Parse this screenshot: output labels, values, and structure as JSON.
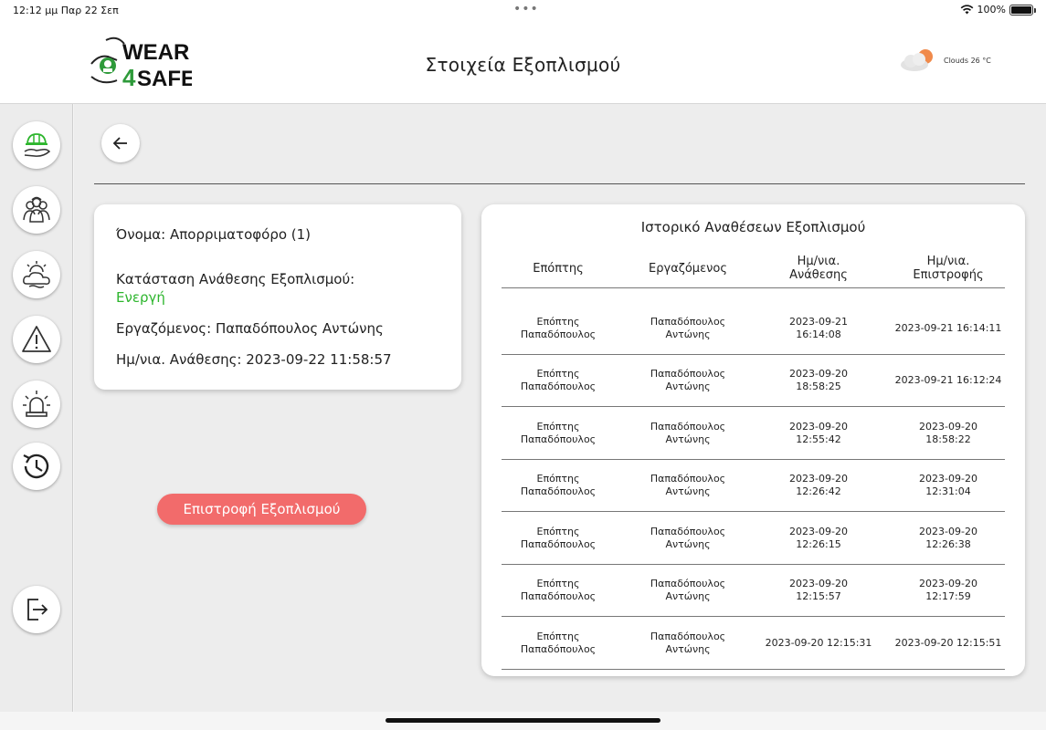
{
  "status_bar": {
    "time": "12:12 μμ   Παρ 22 Σεπ",
    "battery": "100%"
  },
  "header": {
    "logo_text_top": "WEAR",
    "logo_text_mid": "4",
    "logo_text_bottom": "SAFE",
    "title": "Στοιχεία Εξοπλισμού",
    "weather": "Clouds 26 °C"
  },
  "sidebar": {
    "items": [
      "equipment-icon",
      "workers-icon",
      "weather-icon",
      "warning-icon",
      "alarm-icon",
      "history-icon"
    ],
    "logout": "logout-icon"
  },
  "equipment": {
    "name_label": "Όνομα:",
    "name_value": "Απορριματοφόρο (1)",
    "status_label": "Κατάσταση Ανάθεσης Εξοπλισμού:",
    "status_value": "Ενεργή",
    "employee_label": "Εργαζόμενος:",
    "employee_value": "Παπαδόπουλος Αντώνης",
    "date_label": "Ημ/νια. Ανάθεσης:",
    "date_value": "2023-09-22 11:58:57",
    "return_button": "Επιστροφή Εξοπλισμού"
  },
  "colors": {
    "active_status": "#2db52d",
    "return_button": "#f26b6b"
  },
  "history": {
    "title": "Ιστορικό Αναθέσεων Εξοπλισμού",
    "columns": [
      "Επόπτης",
      "Εργαζόμενος",
      "Ημ/νια.\nΑνάθεσης",
      "Ημ/νια.\nΕπιστροφής"
    ],
    "rows": [
      [
        "Επόπτης\nΠαπαδόπουλος",
        "Παπαδόπουλος\nΑντώνης",
        "2023-09-21\n16:14:08",
        "2023-09-21 16:14:11"
      ],
      [
        "Επόπτης\nΠαπαδόπουλος",
        "Παπαδόπουλος\nΑντώνης",
        "2023-09-20\n18:58:25",
        "2023-09-21 16:12:24"
      ],
      [
        "Επόπτης\nΠαπαδόπουλος",
        "Παπαδόπουλος\nΑντώνης",
        "2023-09-20\n12:55:42",
        "2023-09-20\n18:58:22"
      ],
      [
        "Επόπτης\nΠαπαδόπουλος",
        "Παπαδόπουλος\nΑντώνης",
        "2023-09-20\n12:26:42",
        "2023-09-20\n12:31:04"
      ],
      [
        "Επόπτης\nΠαπαδόπουλος",
        "Παπαδόπουλος\nΑντώνης",
        "2023-09-20\n12:26:15",
        "2023-09-20\n12:26:38"
      ],
      [
        "Επόπτης\nΠαπαδόπουλος",
        "Παπαδόπουλος\nΑντώνης",
        "2023-09-20\n12:15:57",
        "2023-09-20\n12:17:59"
      ],
      [
        "Επόπτης\nΠαπαδόπουλος",
        "Παπαδόπουλος\nΑντώνης",
        "2023-09-20 12:15:31",
        "2023-09-20 12:15:51"
      ]
    ]
  }
}
